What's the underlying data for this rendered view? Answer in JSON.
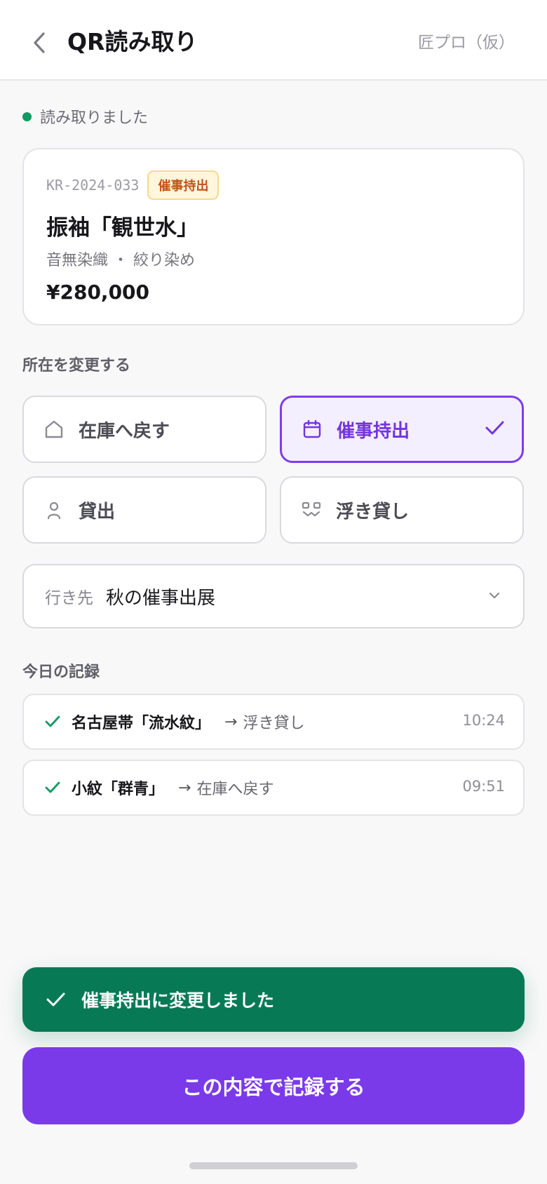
{
  "header": {
    "title": "QR読み取り",
    "app_name": "匠プロ（仮）"
  },
  "status": {
    "text": "読み取りました",
    "color": "#0f9a62"
  },
  "item": {
    "code": "KR-2024-033",
    "badge": "催事持出",
    "name": "振袖「観世水」",
    "meta": "音無染織 ・ 絞り染め",
    "price": "¥280,000"
  },
  "location": {
    "section_label": "所在を変更する",
    "options": [
      {
        "label": "在庫へ戻す",
        "icon": "home-icon",
        "selected": false
      },
      {
        "label": "催事持出",
        "icon": "calendar-icon",
        "selected": true
      },
      {
        "label": "貸出",
        "icon": "person-icon",
        "selected": false
      },
      {
        "label": "浮き貸し",
        "icon": "handover-icon",
        "selected": false
      }
    ],
    "destination": {
      "label": "行き先",
      "value": "秋の催事出展"
    }
  },
  "today": {
    "section_label": "今日の記録",
    "records": [
      {
        "item": "名古屋帯「流水紋」",
        "arrow": "→",
        "destination": "浮き貸し",
        "time": "10:24"
      },
      {
        "item": "小紋「群青」",
        "arrow": "→",
        "destination": "在庫へ戻す",
        "time": "09:51"
      }
    ]
  },
  "toast": {
    "text": "催事持出に変更しました",
    "color": "#077a55"
  },
  "submit": {
    "label": "この内容で記録する",
    "color": "#7b3aea"
  },
  "accent": "#7d3ee8"
}
